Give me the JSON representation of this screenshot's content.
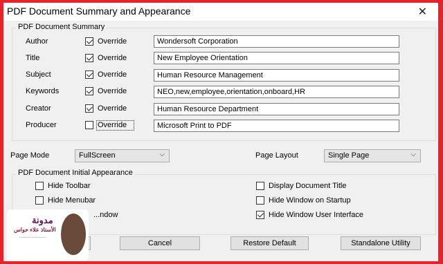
{
  "dialog": {
    "title": "PDF Document Summary and Appearance",
    "close_glyph": "✕"
  },
  "summary": {
    "legend": "PDF Document Summary",
    "rows": [
      {
        "label": "Author",
        "override_checked": true,
        "override_label": "Override",
        "value": "Wondersoft Corporation"
      },
      {
        "label": "Title",
        "override_checked": true,
        "override_label": "Override",
        "value": "New Employee Orientation"
      },
      {
        "label": "Subject",
        "override_checked": true,
        "override_label": "Override",
        "value": "Human Resource Management"
      },
      {
        "label": "Keywords",
        "override_checked": true,
        "override_label": "Override",
        "value": "NEO,new,employee,orientation,onboard,HR"
      },
      {
        "label": "Creator",
        "override_checked": true,
        "override_label": "Override",
        "value": "Human Resource Department"
      },
      {
        "label": "Producer",
        "override_checked": false,
        "override_label": "Override",
        "value": "Microsoft Print to PDF"
      }
    ]
  },
  "page_mode": {
    "label": "Page Mode",
    "value": "FullScreen"
  },
  "page_layout": {
    "label": "Page Layout",
    "value": "Single Page"
  },
  "appearance": {
    "legend": "PDF Document Initial Appearance",
    "hide_toolbar": {
      "label": "Hide Toolbar",
      "checked": false
    },
    "hide_menubar": {
      "label": "Hide Menubar",
      "checked": false
    },
    "hide_window_partial": {
      "label": "...ndow",
      "checked": false
    },
    "display_doc_title": {
      "label": "Display Document Title",
      "checked": false
    },
    "hide_on_startup": {
      "label": "Hide Window on Startup",
      "checked": false
    },
    "hide_window_ui": {
      "label": "Hide Window User Interface",
      "checked": true
    }
  },
  "buttons": {
    "cancel": "Cancel",
    "restore": "Restore Default",
    "standalone": "Standalone Utility"
  },
  "logo": {
    "line1": "مدونة",
    "line2": "الأستاذ علاء حواس",
    "line3": "...................."
  },
  "colors": {
    "background": "#e8212b",
    "dialog": "#f0f0f0"
  },
  "icons": {
    "chevron": "chevron-down-icon",
    "close": "close-icon",
    "check": "checkmark-icon"
  }
}
